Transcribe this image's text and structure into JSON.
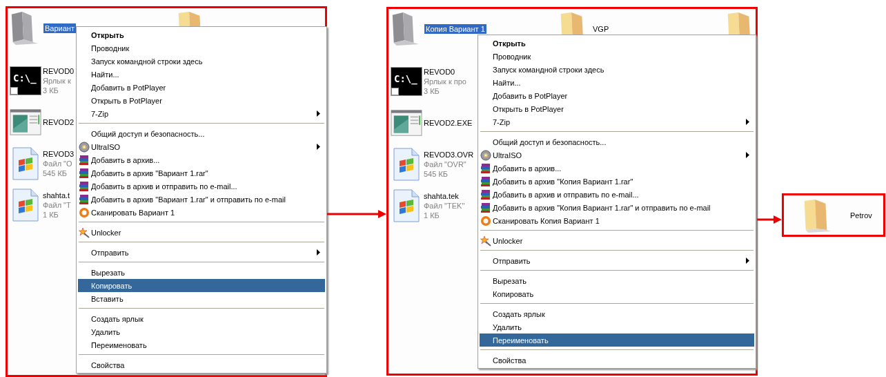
{
  "panels": [
    {
      "folders": [
        {
          "label": "Вариант",
          "kind": "hidden",
          "selected": true
        },
        {
          "kind": "normal",
          "selected": false
        }
      ],
      "files": [
        {
          "kind": "shortcut",
          "icon_text": "C:\\_",
          "lines": [
            "REVOD0",
            "Ярлык к",
            "3 КБ"
          ]
        },
        {
          "kind": "program",
          "lines": [
            "REVOD2"
          ]
        },
        {
          "kind": "document",
          "lines": [
            "REVOD3",
            "Файл \"О",
            "545 КБ"
          ]
        },
        {
          "kind": "document",
          "lines": [
            "shahta.t",
            "Файл \"Т",
            "1 КБ"
          ]
        }
      ],
      "menu": [
        {
          "kind": "default",
          "label": "Открыть",
          "selected": false
        },
        {
          "kind": "plain",
          "label": "Проводник",
          "selected": false
        },
        {
          "kind": "plain",
          "label": "Запуск командной строки здесь",
          "selected": false
        },
        {
          "kind": "plain",
          "label": "Найти...",
          "selected": false
        },
        {
          "kind": "plain",
          "label": "Добавить в PotPlayer",
          "selected": false
        },
        {
          "kind": "plain",
          "label": "Открыть в PotPlayer",
          "selected": false
        },
        {
          "kind": "submenu",
          "label": "7-Zip",
          "selected": false
        },
        {
          "kind": "separator"
        },
        {
          "kind": "plain",
          "label": "Общий доступ и безопасность...",
          "selected": false
        },
        {
          "kind": "iso",
          "label": "UltraISO",
          "selected": false
        },
        {
          "kind": "archive",
          "label": "Добавить в архив...",
          "selected": false
        },
        {
          "kind": "archive",
          "label": "Добавить в архив \"Вариант 1.rar\"",
          "selected": false
        },
        {
          "kind": "archive",
          "label": "Добавить в архив и отправить по e-mail...",
          "selected": false
        },
        {
          "kind": "archive",
          "label": "Добавить в архив \"Вариант 1.rar\" и отправить по e-mail",
          "selected": false
        },
        {
          "kind": "scan",
          "label": "Сканировать Вариант 1",
          "selected": false
        },
        {
          "kind": "separator"
        },
        {
          "kind": "unlock",
          "label": "Unlocker",
          "selected": false
        },
        {
          "kind": "separator"
        },
        {
          "kind": "submenu",
          "label": "Отправить",
          "selected": false
        },
        {
          "kind": "separator"
        },
        {
          "kind": "plain",
          "label": "Вырезать",
          "selected": false
        },
        {
          "kind": "plain",
          "label": "Копировать",
          "selected": true
        },
        {
          "kind": "plain",
          "label": "Вставить",
          "selected": false
        },
        {
          "kind": "separator"
        },
        {
          "kind": "plain",
          "label": "Создать ярлык",
          "selected": false
        },
        {
          "kind": "plain",
          "label": "Удалить",
          "selected": false
        },
        {
          "kind": "plain",
          "label": "Переименовать",
          "selected": false
        },
        {
          "kind": "separator"
        },
        {
          "kind": "plain",
          "label": "Свойства",
          "selected": false
        }
      ]
    },
    {
      "folders": [
        {
          "label": "Копия Вариант 1",
          "kind": "hidden",
          "selected": true
        },
        {
          "label": "VGP",
          "kind": "normal",
          "selected": false
        },
        {
          "kind": "normal",
          "selected": false
        }
      ],
      "files": [
        {
          "kind": "shortcut",
          "icon_text": "C:\\_",
          "lines": [
            "REVOD0",
            "Ярлык к про",
            "3 КБ"
          ]
        },
        {
          "kind": "program",
          "lines": [
            "REVOD2.EXE"
          ]
        },
        {
          "kind": "document",
          "lines": [
            "REVOD3.OVR",
            "Файл \"OVR\"",
            "545 КБ"
          ]
        },
        {
          "kind": "document",
          "lines": [
            "shahta.tek",
            "Файл \"TEK\"",
            "1 КБ"
          ]
        }
      ],
      "menu": [
        {
          "kind": "default",
          "label": "Открыть",
          "selected": false
        },
        {
          "kind": "plain",
          "label": "Проводник",
          "selected": false
        },
        {
          "kind": "plain",
          "label": "Запуск командной строки здесь",
          "selected": false
        },
        {
          "kind": "plain",
          "label": "Найти...",
          "selected": false
        },
        {
          "kind": "plain",
          "label": "Добавить в PotPlayer",
          "selected": false
        },
        {
          "kind": "plain",
          "label": "Открыть в PotPlayer",
          "selected": false
        },
        {
          "kind": "submenu",
          "label": "7-Zip",
          "selected": false
        },
        {
          "kind": "separator"
        },
        {
          "kind": "plain",
          "label": "Общий доступ и безопасность...",
          "selected": false
        },
        {
          "kind": "iso",
          "label": "UltraISO",
          "selected": false
        },
        {
          "kind": "archive",
          "label": "Добавить в архив...",
          "selected": false
        },
        {
          "kind": "archive",
          "label": "Добавить в архив \"Копия Вариант 1.rar\"",
          "selected": false
        },
        {
          "kind": "archive",
          "label": "Добавить в архив и отправить по e-mail...",
          "selected": false
        },
        {
          "kind": "archive",
          "label": "Добавить в архив \"Копия Вариант 1.rar\" и отправить по e-mail",
          "selected": false
        },
        {
          "kind": "scan",
          "label": "Сканировать Копия Вариант 1",
          "selected": false
        },
        {
          "kind": "separator"
        },
        {
          "kind": "unlock",
          "label": "Unlocker",
          "selected": false
        },
        {
          "kind": "separator"
        },
        {
          "kind": "submenu",
          "label": "Отправить",
          "selected": false
        },
        {
          "kind": "separator"
        },
        {
          "kind": "plain",
          "label": "Вырезать",
          "selected": false
        },
        {
          "kind": "plain",
          "label": "Копировать",
          "selected": false
        },
        {
          "kind": "separator"
        },
        {
          "kind": "plain",
          "label": "Создать ярлык",
          "selected": false
        },
        {
          "kind": "plain",
          "label": "Удалить",
          "selected": false
        },
        {
          "kind": "plain",
          "label": "Переименовать",
          "selected": true
        },
        {
          "kind": "separator"
        },
        {
          "kind": "plain",
          "label": "Свойства",
          "selected": false
        }
      ]
    }
  ],
  "target": {
    "label": "Petrov"
  }
}
